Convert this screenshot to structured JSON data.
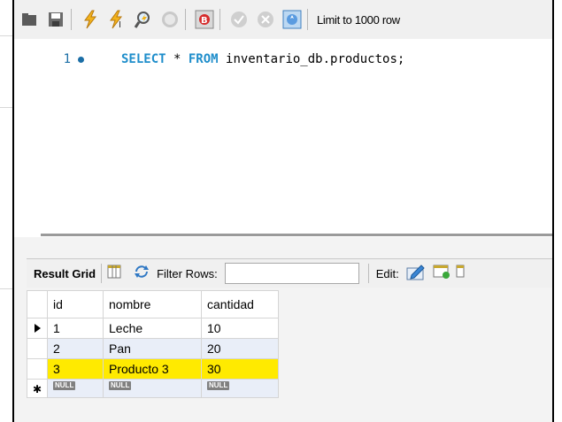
{
  "toolbar": {
    "limit_label": "Limit to 1000 row",
    "icons": [
      "open-folder-icon",
      "save-icon",
      "execute-icon",
      "execute-current-icon",
      "explain-icon",
      "stop-icon",
      "toggle-error-icon",
      "commit-icon",
      "rollback-icon",
      "autocommit-icon"
    ]
  },
  "editor": {
    "line_number": "1",
    "tokens": {
      "kw1": "SELECT",
      "mid1": " * ",
      "kw2": "FROM",
      "rest": " inventario_db.productos;"
    }
  },
  "result_toolbar": {
    "grid_label": "Result Grid",
    "filter_label": "Filter Rows:",
    "filter_value": "",
    "edit_label": "Edit:"
  },
  "grid": {
    "columns": [
      "id",
      "nombre",
      "cantidad"
    ],
    "rows": [
      {
        "id": "1",
        "nombre": "Leche",
        "cantidad": "10"
      },
      {
        "id": "2",
        "nombre": "Pan",
        "cantidad": "20"
      },
      {
        "id": "3",
        "nombre": "Producto 3",
        "cantidad": "30"
      }
    ],
    "null_label": "NULL",
    "highlight_color": "#ffea00"
  }
}
